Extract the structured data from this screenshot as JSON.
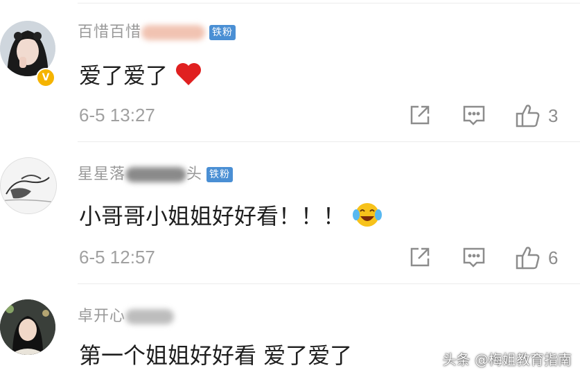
{
  "comments": [
    {
      "username": "百惜百惜",
      "badge": "铁粉",
      "text": "爱了爱了",
      "emoji": "heart-emoji",
      "time": "6-5 13:27",
      "like_count": "3"
    },
    {
      "username": "星星落",
      "username_tail": "头",
      "badge": "铁粉",
      "text": "小哥哥小姐姐好好看！！！",
      "emoji": "crying-laughing-emoji",
      "time": "6-5 12:57",
      "like_count": "6"
    },
    {
      "username": "卓开心",
      "text": "第一个姐姐好好看 爱了爱了"
    }
  ],
  "watermark": "头条 @梅姐教育指南",
  "colors": {
    "badge": "#4a8fd4",
    "verified": "#f5b400",
    "heart": "#e02020",
    "meta": "#a0a0a0"
  }
}
